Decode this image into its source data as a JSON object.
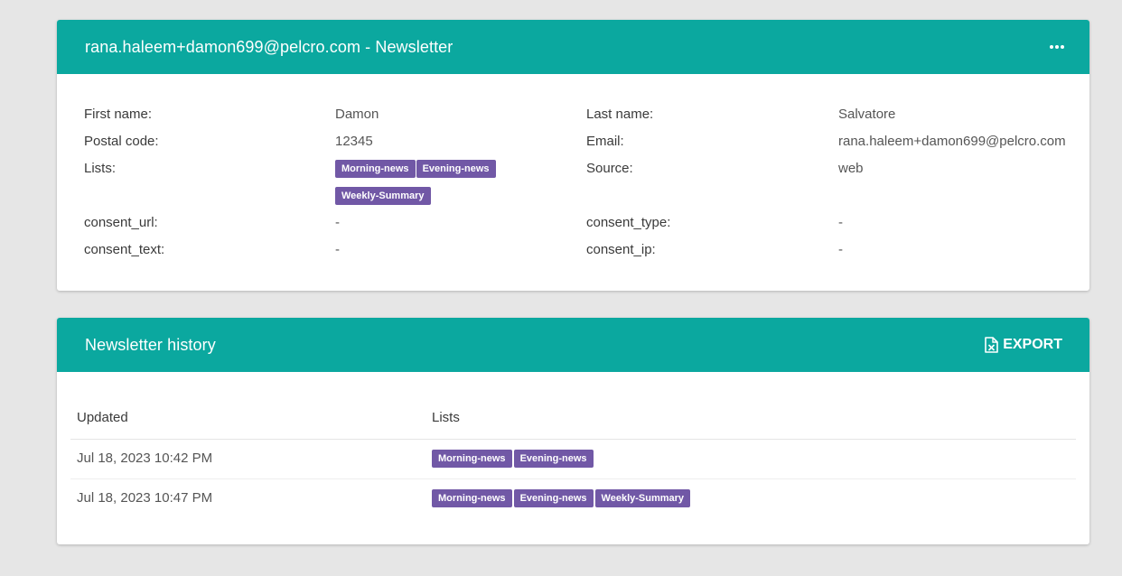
{
  "colors": {
    "header_bg": "#0ba89f",
    "tag_bg": "#7158a6",
    "page_bg": "#e6e6e6"
  },
  "profile": {
    "title": "rana.haleem+damon699@pelcro.com - Newsletter",
    "more_icon": "more-horizontal-icon",
    "fields": {
      "first_name_label": "First name:",
      "first_name": "Damon",
      "last_name_label": "Last name:",
      "last_name": "Salvatore",
      "postal_code_label": "Postal code:",
      "postal_code": "12345",
      "email_label": "Email:",
      "email": "rana.haleem+damon699@pelcro.com",
      "lists_label": "Lists:",
      "lists": [
        "Morning-news",
        "Evening-news",
        "Weekly-Summary"
      ],
      "source_label": "Source:",
      "source": "web",
      "consent_url_label": "consent_url:",
      "consent_url": "-",
      "consent_type_label": "consent_type:",
      "consent_type": "-",
      "consent_text_label": "consent_text:",
      "consent_text": "-",
      "consent_ip_label": "consent_ip:",
      "consent_ip": "-"
    }
  },
  "history": {
    "title": "Newsletter history",
    "export_label": "EXPORT",
    "export_icon": "excel-file-icon",
    "columns": [
      "Updated",
      "Lists"
    ],
    "rows": [
      {
        "updated": "Jul 18, 2023 10:42 PM",
        "lists": [
          "Morning-news",
          "Evening-news"
        ]
      },
      {
        "updated": "Jul 18, 2023 10:47 PM",
        "lists": [
          "Morning-news",
          "Evening-news",
          "Weekly-Summary"
        ]
      }
    ]
  }
}
